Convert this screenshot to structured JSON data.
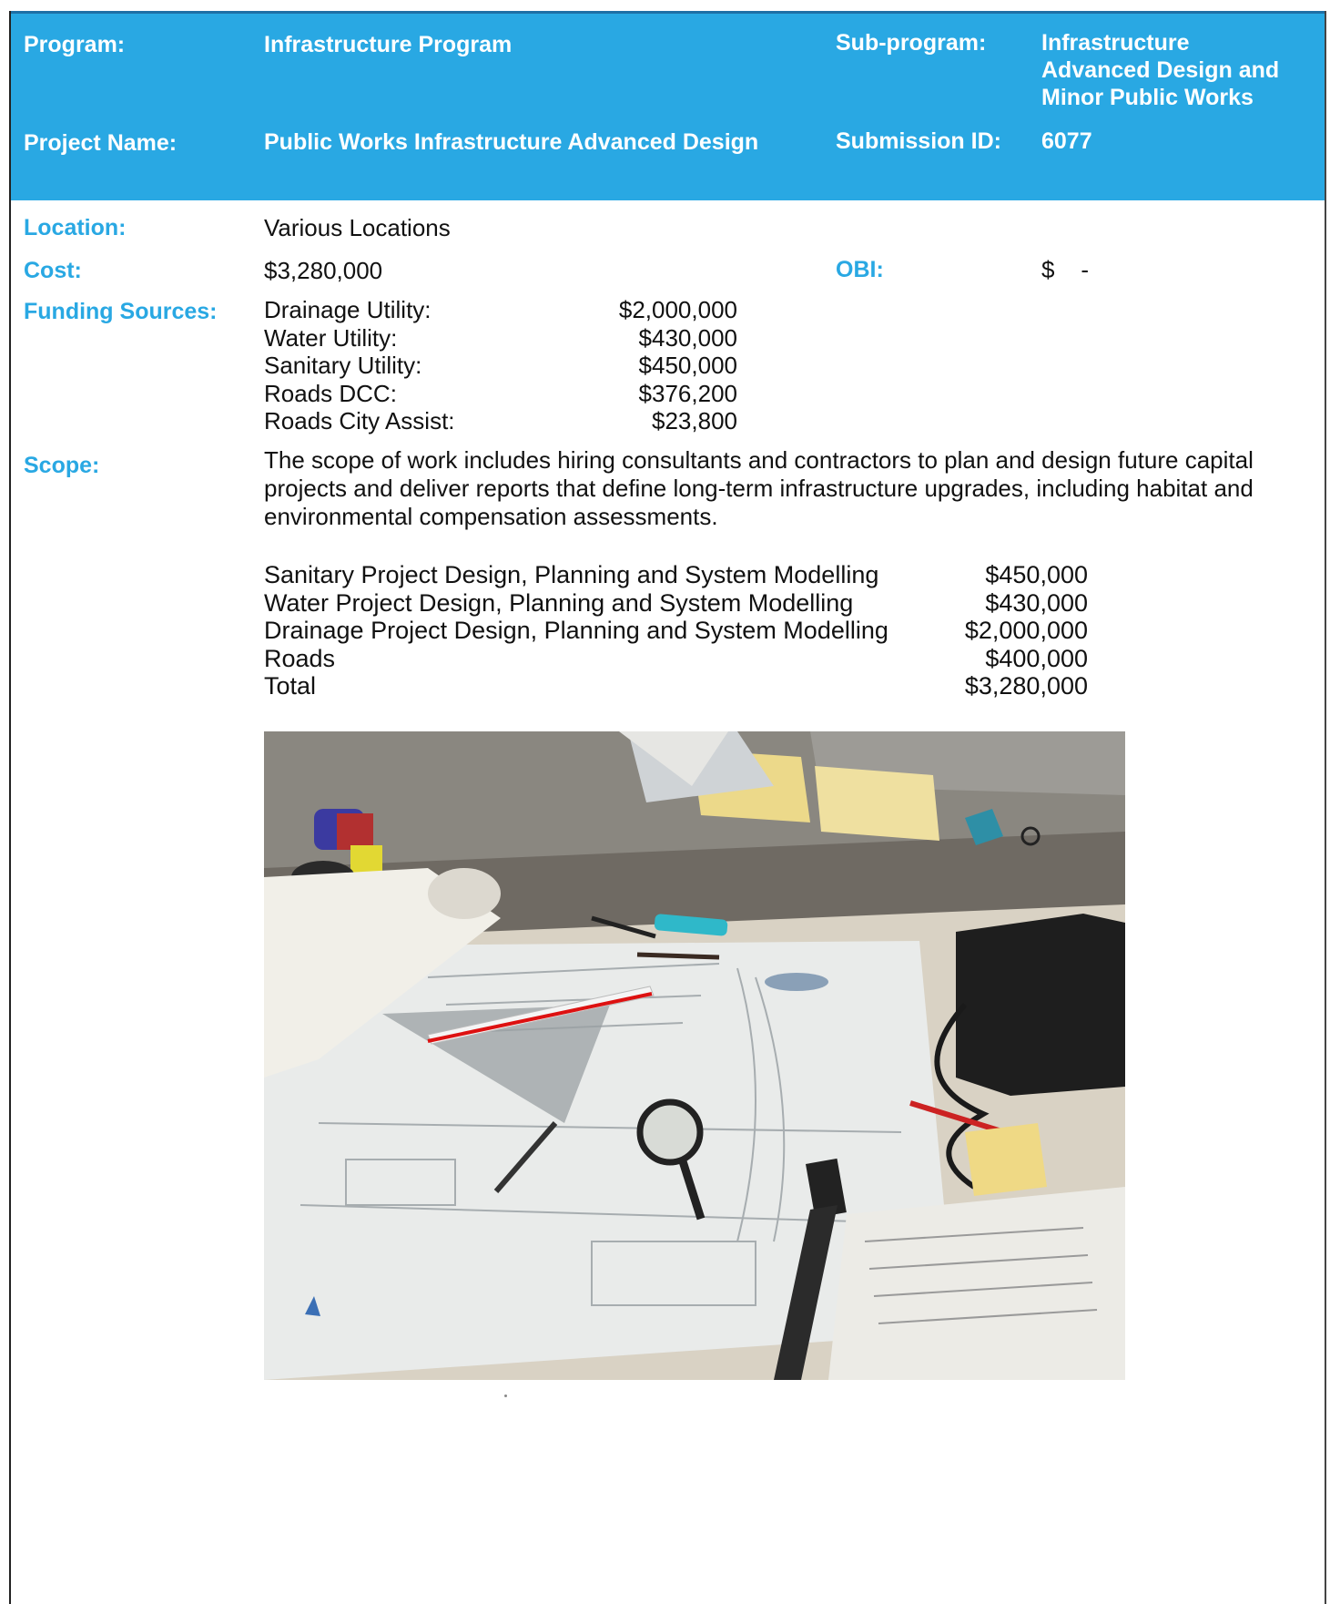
{
  "header": {
    "program_label": "Program:",
    "program_value": "Infrastructure Program",
    "subprogram_label": "Sub-program:",
    "subprogram_value_lines": [
      "Infrastructure",
      "Advanced Design and",
      "Minor Public Works"
    ],
    "project_name_label": "Project Name:",
    "project_name_value": "Public Works Infrastructure Advanced Design",
    "submission_id_label": "Submission ID:",
    "submission_id_value": "6077"
  },
  "details": {
    "location_label": "Location:",
    "location_value": "Various Locations",
    "cost_label": "Cost:",
    "cost_value": "$3,280,000",
    "obi_label": "OBI:",
    "obi_value": "$    -",
    "funding_label": "Funding Sources:",
    "funding_sources": [
      {
        "name": "Drainage Utility:",
        "amount": "$2,000,000"
      },
      {
        "name": "Water Utility:",
        "amount": "$430,000"
      },
      {
        "name": "Sanitary Utility:",
        "amount": "$450,000"
      },
      {
        "name": "Roads DCC:",
        "amount": "$376,200"
      },
      {
        "name": "Roads City Assist:",
        "amount": "$23,800"
      }
    ],
    "scope_label": "Scope:",
    "scope_text": "The scope of work includes hiring consultants and contractors to plan and design future capital projects and deliver reports that define long-term infrastructure upgrades, including habitat and environmental compensation assessments.",
    "breakdown": [
      {
        "name": "Sanitary Project Design, Planning and System Modelling",
        "amount": "$450,000"
      },
      {
        "name": "Water Project Design, Planning and System Modelling",
        "amount": "$430,000"
      },
      {
        "name": "Drainage Project Design, Planning and System Modelling",
        "amount": "$2,000,000"
      },
      {
        "name": "Roads",
        "amount": "$400,000"
      },
      {
        "name": "Total",
        "amount": "$3,280,000"
      }
    ]
  },
  "colors": {
    "accent": "#29a8e3",
    "header_text": "#ffffff",
    "body_text": "#111111"
  }
}
